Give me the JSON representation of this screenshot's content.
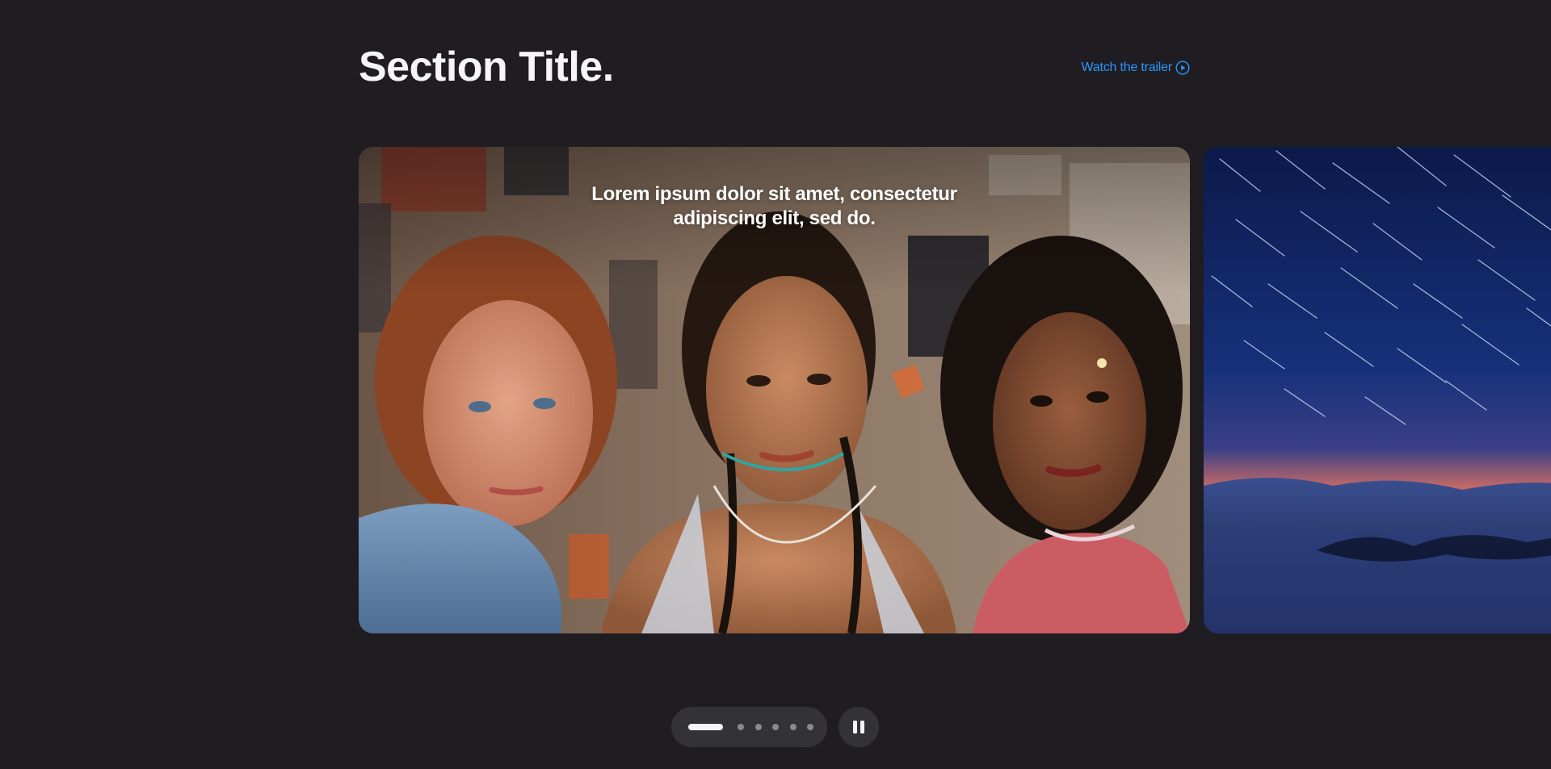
{
  "header": {
    "title": "Section Title.",
    "link_label": "Watch the trailer",
    "link_icon": "play-circle-icon",
    "link_color": "#2997ff"
  },
  "gallery": {
    "items": [
      {
        "caption_line1": "Lorem ipsum dolor sit amet, consectetur",
        "caption_line2": "adipiscing elit, sed do."
      },
      {
        "caption_line1": "",
        "caption_line2": ""
      }
    ],
    "active_index": 0,
    "total": 6
  },
  "controls": {
    "pause_icon": "pause-icon"
  },
  "colors": {
    "background": "#1f1d22",
    "pill": "#333237",
    "text": "#f5f5f7"
  }
}
